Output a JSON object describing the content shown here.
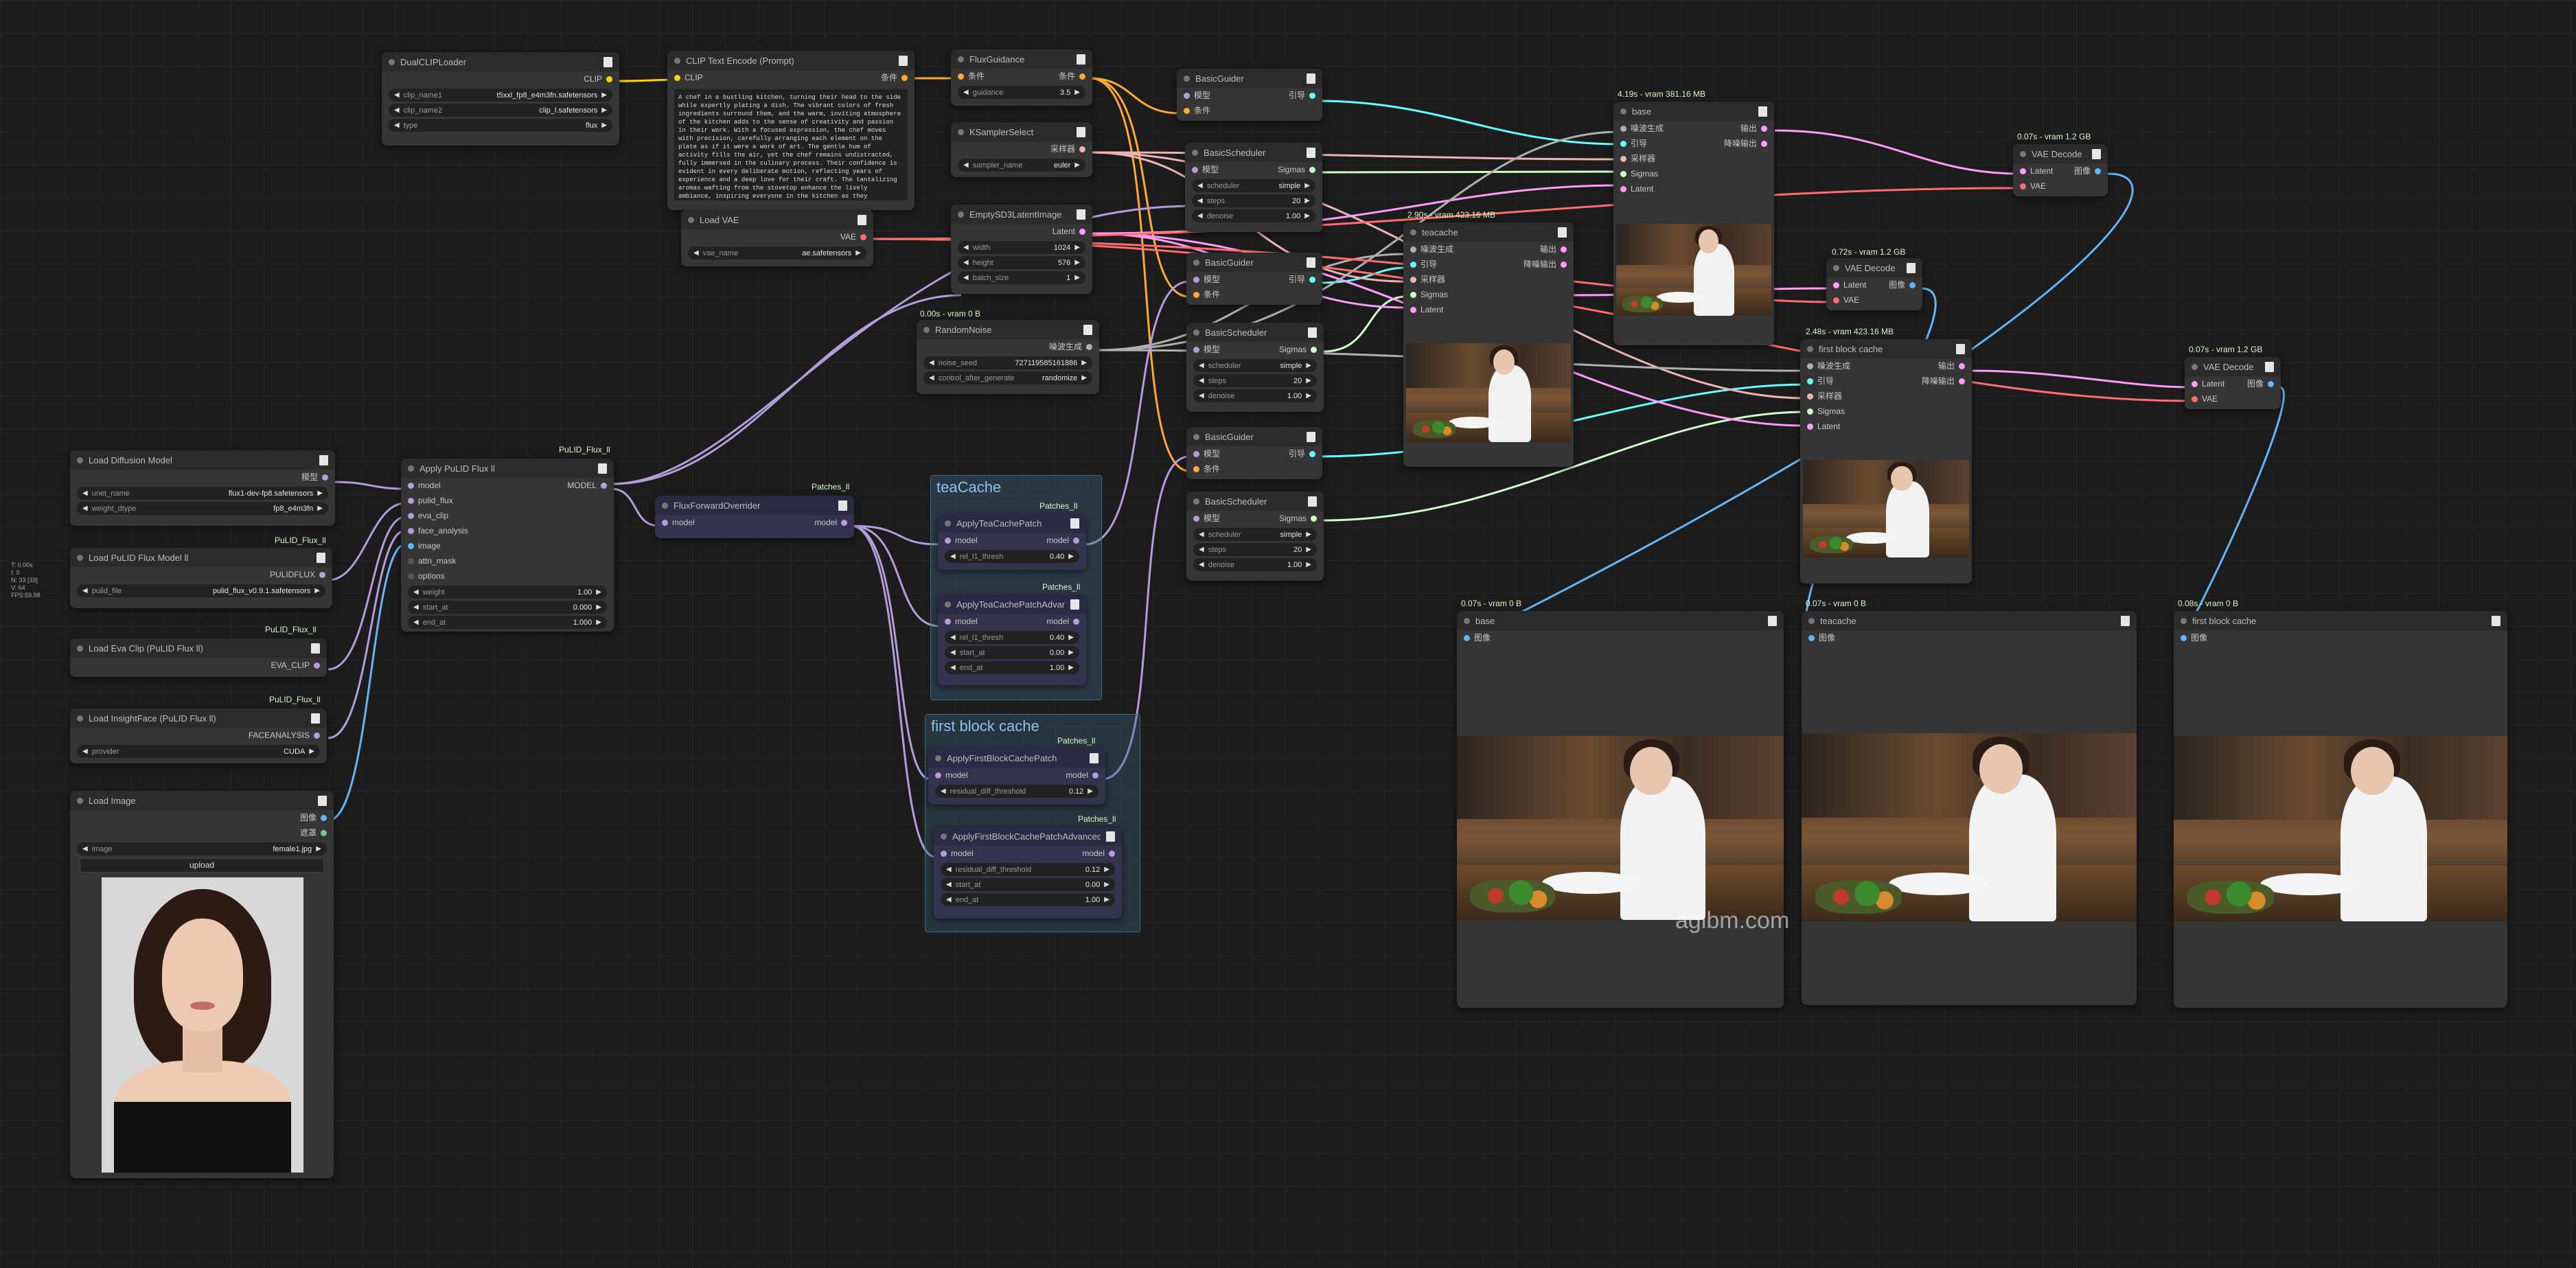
{
  "stats": {
    "lines": [
      "T: 0.00s",
      "I: 0",
      "N: 33 [33]",
      "V: 64",
      "FPS:59.98"
    ]
  },
  "watermark": "agibm.com",
  "groups": {
    "teacache": "teaCache",
    "fbcache": "first block cache"
  },
  "tags": {
    "pulid_flux_ll_1": "PuLID_Flux_ll",
    "pulid_flux_ll_2": "PuLID_Flux_ll",
    "pulid_flux_ll_3": "PuLID_Flux_ll",
    "pulid_flux_ll_4": "PuLID_Flux_ll",
    "patches_1": "Patches_ll",
    "patches_2": "Patches_ll",
    "patches_3": "Patches_ll",
    "patches_4": "Patches_ll",
    "patches_5": "Patches_ll"
  },
  "badges": {
    "random_noise": "0.00s - vram 0 B",
    "base_sampler": "4.19s - vram 381.16 MB",
    "teacache_sampler": "2.90s - vram 423.16 MB",
    "fbc_sampler": "2.48s - vram 423.16 MB",
    "vae1": "0.07s - vram 1.2 GB",
    "vae2": "0.72s - vram 1.2 GB",
    "vae3": "0.07s - vram 1.2 GB",
    "prev_base": "0.07s - vram 0 B",
    "prev_teacache": "0.07s - vram 0 B",
    "prev_fbc": "0.08s - vram 0 B"
  },
  "nodes": {
    "dualclip": {
      "title": "DualCLIPLoader",
      "out": "CLIP",
      "w": [
        [
          "clip_name1",
          "t5xxl_fp8_e4m3fn.safetensors"
        ],
        [
          "clip_name2",
          "clip_l.safetensors"
        ],
        [
          "type",
          "flux"
        ]
      ]
    },
    "cliptext": {
      "title": "CLIP Text Encode (Prompt)",
      "in": "CLIP",
      "out": "条件",
      "text": "A chef in a bustling kitchen, turning their head to the side while expertly plating a dish. The vibrant colors of fresh ingredients surround them, and the warm, inviting atmosphere of the kitchen adds to the sense of creativity and passion in their work. With a focused expression, the chef moves with precision, carefully arranging each element on the plate as if it were a work of art. The gentle hum of activity fills the air, yet the chef remains undistracted, fully immersed in the culinary process. Their confidence is evident in every deliberate motion, reflecting years of experience and a deep love for their craft. The tantalizing aromas wafting from the stovetop enhance the lively ambiance, inspiring everyone in the kitchen as they collaborate to create unforgettable flavors."
    },
    "loadvae": {
      "title": "Load VAE",
      "out": "VAE",
      "w": [
        [
          "vae_name",
          "ae.safetensors"
        ]
      ]
    },
    "fluxguid": {
      "title": "FluxGuidance",
      "in": "条件",
      "out": "条件",
      "w": [
        [
          "guidance",
          "3.5"
        ]
      ]
    },
    "ksel": {
      "title": "KSamplerSelect",
      "out": "采样器",
      "w": [
        [
          "sampler_name",
          "euler"
        ]
      ]
    },
    "empty": {
      "title": "EmptySD3LatentImage",
      "out": "Latent",
      "w": [
        [
          "width",
          "1024"
        ],
        [
          "height",
          "576"
        ],
        [
          "batch_size",
          "1"
        ]
      ]
    },
    "rnoise": {
      "title": "RandomNoise",
      "out": "噪波生成",
      "w": [
        [
          "noise_seed",
          "727119585161886"
        ],
        [
          "control_after_generate",
          "randomize"
        ]
      ]
    },
    "bg1": {
      "title": "BasicGuider",
      "in1": "模型",
      "in2": "条件",
      "out": "引导"
    },
    "bs1": {
      "title": "BasicScheduler",
      "in": "模型",
      "out": "Sigmas",
      "w": [
        [
          "scheduler",
          "simple"
        ],
        [
          "steps",
          "20"
        ],
        [
          "denoise",
          "1.00"
        ]
      ]
    },
    "bg2": {
      "title": "BasicGuider",
      "in1": "模型",
      "in2": "条件",
      "out": "引导"
    },
    "bs2": {
      "title": "BasicScheduler",
      "in": "模型",
      "out": "Sigmas",
      "w": [
        [
          "scheduler",
          "simple"
        ],
        [
          "steps",
          "20"
        ],
        [
          "denoise",
          "1.00"
        ]
      ]
    },
    "bg3": {
      "title": "BasicGuider",
      "in1": "模型",
      "in2": "条件",
      "out": "引导"
    },
    "bs3": {
      "title": "BasicScheduler",
      "in": "模型",
      "out": "Sigmas",
      "w": [
        [
          "scheduler",
          "simple"
        ],
        [
          "steps",
          "20"
        ],
        [
          "denoise",
          "1.00"
        ]
      ]
    },
    "base": {
      "title": "base",
      "ins": [
        "噪波生成",
        "引导",
        "采样器",
        "Sigmas",
        "Latent"
      ],
      "outs": [
        "输出",
        "降噪输出"
      ]
    },
    "teacache": {
      "title": "teacache",
      "ins": [
        "噪波生成",
        "引导",
        "采样器",
        "Sigmas",
        "Latent"
      ],
      "outs": [
        "输出",
        "降噪输出"
      ]
    },
    "fbc": {
      "title": "first block cache",
      "ins": [
        "噪波生成",
        "引导",
        "采样器",
        "Sigmas",
        "Latent"
      ],
      "outs": [
        "输出",
        "降噪输出"
      ]
    },
    "vae1": {
      "title": "VAE Decode",
      "ins": [
        "Latent",
        "VAE"
      ],
      "out": "图像"
    },
    "vae2": {
      "title": "VAE Decode",
      "ins": [
        "Latent",
        "VAE"
      ],
      "out": "图像"
    },
    "vae3": {
      "title": "VAE Decode",
      "ins": [
        "Latent",
        "VAE"
      ],
      "out": "图像"
    },
    "loaddiff": {
      "title": "Load Diffusion Model",
      "out": "模型",
      "w": [
        [
          "unet_name",
          "flux1-dev-fp8.safetensors"
        ],
        [
          "weight_dtype",
          "fp8_e4m3fn"
        ]
      ]
    },
    "loadpulid": {
      "title": "Load PuLID Flux Model ll",
      "out": "PULIDFLUX",
      "w": [
        [
          "pulid_file",
          "pulid_flux_v0.9.1.safetensors"
        ]
      ]
    },
    "evaclip": {
      "title": "Load Eva Clip (PuLID Flux ll)",
      "out": "EVA_CLIP"
    },
    "insight": {
      "title": "Load InsightFace (PuLID Flux ll)",
      "out": "FACEANALYSIS",
      "w": [
        [
          "provider",
          "CUDA"
        ]
      ]
    },
    "loadimg": {
      "title": "Load Image",
      "outs": [
        "图像",
        "遮罩"
      ],
      "w": [
        [
          "image",
          "female1.jpg"
        ]
      ],
      "btn": "upload"
    },
    "applypulid": {
      "title": "Apply PuLID Flux ll",
      "ins": [
        "model",
        "pulid_flux",
        "eva_clip",
        "face_analysis",
        "image",
        "attn_mask",
        "options"
      ],
      "out": "MODEL",
      "w": [
        [
          "weight",
          "1.00"
        ],
        [
          "start_at",
          "0.000"
        ],
        [
          "end_at",
          "1.000"
        ]
      ]
    },
    "ffo": {
      "title": "FluxForwardOverrider",
      "in": "model",
      "out": "model"
    },
    "atcp": {
      "title": "ApplyTeaCachePatch",
      "in": "model",
      "out": "model",
      "w": [
        [
          "rel_l1_thresh",
          "0.40"
        ]
      ]
    },
    "atcpa": {
      "title": "ApplyTeaCachePatchAdvanced",
      "in": "model",
      "out": "model",
      "w": [
        [
          "rel_l1_thresh",
          "0.40"
        ],
        [
          "start_at",
          "0.00"
        ],
        [
          "end_at",
          "1.00"
        ]
      ]
    },
    "afbc": {
      "title": "ApplyFirstBlockCachePatch",
      "in": "model",
      "out": "model",
      "w": [
        [
          "residual_diff_threshold",
          "0.12"
        ]
      ]
    },
    "afbca": {
      "title": "ApplyFirstBlockCachePatchAdvanced",
      "in": "model",
      "out": "model",
      "w": [
        [
          "residual_diff_threshold",
          "0.12"
        ],
        [
          "start_at",
          "0.00"
        ],
        [
          "end_at",
          "1.00"
        ]
      ]
    },
    "prev_base": {
      "title": "base",
      "in": "图像"
    },
    "prev_teacache": {
      "title": "teacache",
      "in": "图像"
    },
    "prev_fbc": {
      "title": "first block cache",
      "in": "图像"
    }
  },
  "colors": {
    "model": "#b39ddb",
    "clip": "#ffd500",
    "conditioning": "#ffa931",
    "vae": "#ff6e6e",
    "latent": "#ff9cf9",
    "image": "#64b5f6",
    "sigmas": "#cdffcd",
    "sampler": "#ecb4b4",
    "guider": "#66ffff",
    "noise": "#b0b0b0"
  }
}
